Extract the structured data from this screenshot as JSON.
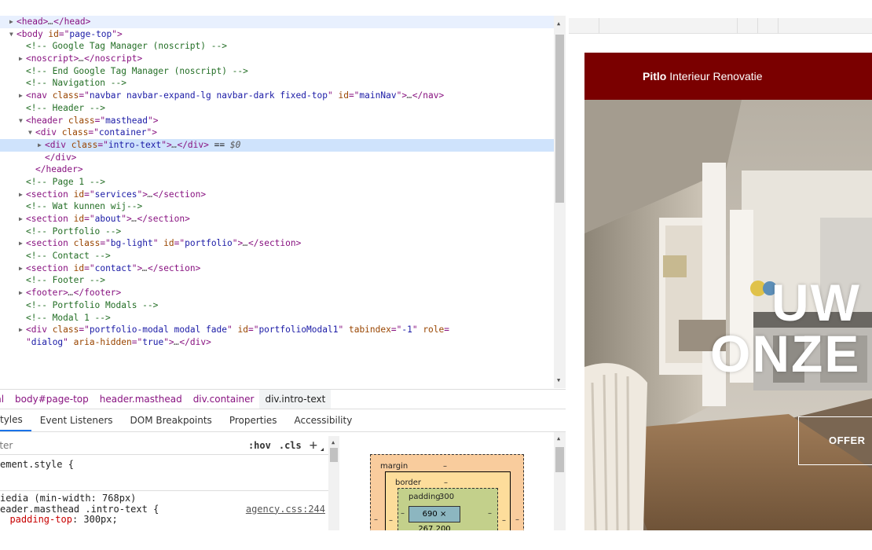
{
  "dom_tree": [
    {
      "arrow": "▶",
      "indent": 0,
      "parts": [
        [
          "tag",
          "<head>"
        ],
        [
          "dm",
          "…"
        ],
        [
          "tag",
          "</head>"
        ]
      ],
      "hl": true
    },
    {
      "arrow": "▼",
      "indent": 0,
      "parts": [
        [
          "tag",
          "<body "
        ],
        [
          "an",
          "id"
        ],
        [
          "tag",
          "=\""
        ],
        [
          "av",
          "page-top"
        ],
        [
          "tag",
          "\">"
        ]
      ]
    },
    {
      "arrow": "",
      "indent": 1,
      "parts": [
        [
          "cm",
          "<!-- Google Tag Manager (noscript) -->"
        ]
      ]
    },
    {
      "arrow": "▶",
      "indent": 1,
      "parts": [
        [
          "tag",
          "<noscript>"
        ],
        [
          "dm",
          "…"
        ],
        [
          "tag",
          "</noscript>"
        ]
      ]
    },
    {
      "arrow": "",
      "indent": 1,
      "parts": [
        [
          "cm",
          "<!-- End Google Tag Manager (noscript) -->"
        ]
      ]
    },
    {
      "arrow": "",
      "indent": 1,
      "parts": [
        [
          "cm",
          "<!-- Navigation -->"
        ]
      ]
    },
    {
      "arrow": "▶",
      "indent": 1,
      "parts": [
        [
          "tag",
          "<nav "
        ],
        [
          "an",
          "class"
        ],
        [
          "tag",
          "=\""
        ],
        [
          "av",
          "navbar navbar-expand-lg navbar-dark fixed-top"
        ],
        [
          "tag",
          "\" "
        ],
        [
          "an",
          "id"
        ],
        [
          "tag",
          "=\""
        ],
        [
          "av",
          "mainNav"
        ],
        [
          "tag",
          "\">"
        ],
        [
          "dm",
          "…"
        ],
        [
          "tag",
          "</nav>"
        ]
      ]
    },
    {
      "arrow": "",
      "indent": 1,
      "parts": [
        [
          "cm",
          "<!-- Header -->"
        ]
      ]
    },
    {
      "arrow": "▼",
      "indent": 1,
      "parts": [
        [
          "tag",
          "<header "
        ],
        [
          "an",
          "class"
        ],
        [
          "tag",
          "=\""
        ],
        [
          "av",
          "masthead"
        ],
        [
          "tag",
          "\">"
        ]
      ]
    },
    {
      "arrow": "▼",
      "indent": 2,
      "parts": [
        [
          "tag",
          "<div "
        ],
        [
          "an",
          "class"
        ],
        [
          "tag",
          "=\""
        ],
        [
          "av",
          "container"
        ],
        [
          "tag",
          "\">"
        ]
      ]
    },
    {
      "arrow": "▶",
      "indent": 3,
      "parts": [
        [
          "tag",
          "<div "
        ],
        [
          "an",
          "class"
        ],
        [
          "tag",
          "=\""
        ],
        [
          "av",
          "intro-text"
        ],
        [
          "tag",
          "\">"
        ],
        [
          "dm",
          "…"
        ],
        [
          "tag",
          "</div>"
        ],
        [
          "tx",
          " == "
        ],
        [
          "dm",
          "$0"
        ]
      ],
      "sel": true
    },
    {
      "arrow": "",
      "indent": 3,
      "parts": [
        [
          "tag",
          "</div>"
        ]
      ]
    },
    {
      "arrow": "",
      "indent": 2,
      "parts": [
        [
          "tag",
          "</header>"
        ]
      ]
    },
    {
      "arrow": "",
      "indent": 1,
      "parts": [
        [
          "cm",
          "<!-- Page 1 -->"
        ]
      ]
    },
    {
      "arrow": "▶",
      "indent": 1,
      "parts": [
        [
          "tag",
          "<section "
        ],
        [
          "an",
          "id"
        ],
        [
          "tag",
          "=\""
        ],
        [
          "av",
          "services"
        ],
        [
          "tag",
          "\">"
        ],
        [
          "dm",
          "…"
        ],
        [
          "tag",
          "</section>"
        ]
      ]
    },
    {
      "arrow": "",
      "indent": 1,
      "parts": [
        [
          "cm",
          "<!-- Wat kunnen wij-->"
        ]
      ]
    },
    {
      "arrow": "▶",
      "indent": 1,
      "parts": [
        [
          "tag",
          "<section "
        ],
        [
          "an",
          "id"
        ],
        [
          "tag",
          "=\""
        ],
        [
          "av",
          "about"
        ],
        [
          "tag",
          "\">"
        ],
        [
          "dm",
          "…"
        ],
        [
          "tag",
          "</section>"
        ]
      ]
    },
    {
      "arrow": "",
      "indent": 1,
      "parts": [
        [
          "cm",
          "<!-- Portfolio -->"
        ]
      ]
    },
    {
      "arrow": "▶",
      "indent": 1,
      "parts": [
        [
          "tag",
          "<section "
        ],
        [
          "an",
          "class"
        ],
        [
          "tag",
          "=\""
        ],
        [
          "av",
          "bg-light"
        ],
        [
          "tag",
          "\" "
        ],
        [
          "an",
          "id"
        ],
        [
          "tag",
          "=\""
        ],
        [
          "av",
          "portfolio"
        ],
        [
          "tag",
          "\">"
        ],
        [
          "dm",
          "…"
        ],
        [
          "tag",
          "</section>"
        ]
      ]
    },
    {
      "arrow": "",
      "indent": 1,
      "parts": [
        [
          "cm",
          "<!-- Contact -->"
        ]
      ]
    },
    {
      "arrow": "▶",
      "indent": 1,
      "parts": [
        [
          "tag",
          "<section "
        ],
        [
          "an",
          "id"
        ],
        [
          "tag",
          "=\""
        ],
        [
          "av",
          "contact"
        ],
        [
          "tag",
          "\">"
        ],
        [
          "dm",
          "…"
        ],
        [
          "tag",
          "</section>"
        ]
      ]
    },
    {
      "arrow": "",
      "indent": 1,
      "parts": [
        [
          "cm",
          "<!-- Footer -->"
        ]
      ]
    },
    {
      "arrow": "▶",
      "indent": 1,
      "parts": [
        [
          "tag",
          "<footer>"
        ],
        [
          "dm",
          "…"
        ],
        [
          "tag",
          "</footer>"
        ]
      ]
    },
    {
      "arrow": "",
      "indent": 1,
      "parts": [
        [
          "cm",
          "<!-- Portfolio Modals -->"
        ]
      ]
    },
    {
      "arrow": "",
      "indent": 1,
      "parts": [
        [
          "cm",
          "<!-- Modal 1 -->"
        ]
      ]
    },
    {
      "arrow": "▶",
      "indent": 1,
      "parts": [
        [
          "tag",
          "<div "
        ],
        [
          "an",
          "class"
        ],
        [
          "tag",
          "=\""
        ],
        [
          "av",
          "portfolio-modal modal fade"
        ],
        [
          "tag",
          "\" "
        ],
        [
          "an",
          "id"
        ],
        [
          "tag",
          "=\""
        ],
        [
          "av",
          "portfolioModal1"
        ],
        [
          "tag",
          "\" "
        ],
        [
          "an",
          "tabindex"
        ],
        [
          "tag",
          "=\""
        ],
        [
          "av",
          "-1"
        ],
        [
          "tag",
          "\" "
        ],
        [
          "an",
          "role"
        ],
        [
          "tag",
          "="
        ]
      ]
    },
    {
      "arrow": "",
      "indent": 0,
      "parts": [
        [
          "tag",
          "\""
        ],
        [
          "av",
          "dialog"
        ],
        [
          "tag",
          "\" "
        ],
        [
          "an",
          "aria-hidden"
        ],
        [
          "tag",
          "=\""
        ],
        [
          "av",
          "true"
        ],
        [
          "tag",
          "\">"
        ],
        [
          "dm",
          "…"
        ],
        [
          "tag",
          "</div>"
        ]
      ]
    }
  ],
  "breadcrumb": [
    "ml",
    "body#page-top",
    "header.masthead",
    "div.container",
    "div.intro-text"
  ],
  "styles_tabs": [
    "tyles",
    "Event Listeners",
    "DOM Breakpoints",
    "Properties",
    "Accessibility"
  ],
  "filter": {
    "placeholder": "lter",
    "hov": ":hov",
    "cls": ".cls",
    "add": "+"
  },
  "styles": {
    "element_style": "ement.style {",
    "media": "iedia (min-width: 768px)",
    "selector": "eader.masthead .intro-text {",
    "source": "agency.css:244",
    "prop_name": "padding-top",
    "prop_value": ": 300px;"
  },
  "box_model": {
    "margin_label": "margin",
    "margin_value": "–",
    "border_label": "border",
    "border_value": "–",
    "padding_label": "padding",
    "padding_value": "300",
    "content": "690 × 267.200",
    "dash": "–"
  },
  "site": {
    "brand_bold": "Pitlo",
    "brand_rest": " Interieur Renovatie",
    "heading_line1": "UW",
    "heading_line2": "ONZE",
    "button_label": "OFFER",
    "nav_color": "#7a0000"
  },
  "colors": {
    "tag": "#881280",
    "attr_name": "#994500",
    "attr_value": "#1a1aa6",
    "comment": "#236e25",
    "selected_row": "#cfe3fc",
    "tab_underline": "#1a73e8"
  }
}
